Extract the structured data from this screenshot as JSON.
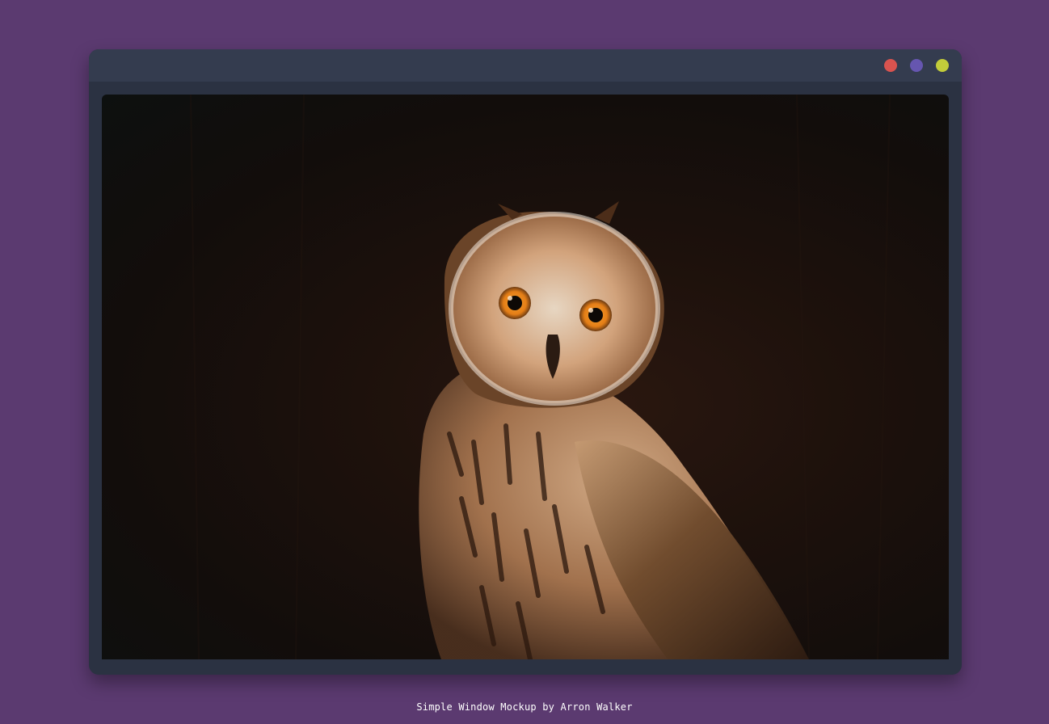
{
  "window": {
    "controls": [
      {
        "name": "close",
        "color": "#d9534f"
      },
      {
        "name": "minimize",
        "color": "#6656b0"
      },
      {
        "name": "maximize",
        "color": "#c2cc3a"
      }
    ]
  },
  "content": {
    "image_icon": "owl-photo"
  },
  "footer": {
    "caption": "Simple Window Mockup by Arron Walker"
  }
}
